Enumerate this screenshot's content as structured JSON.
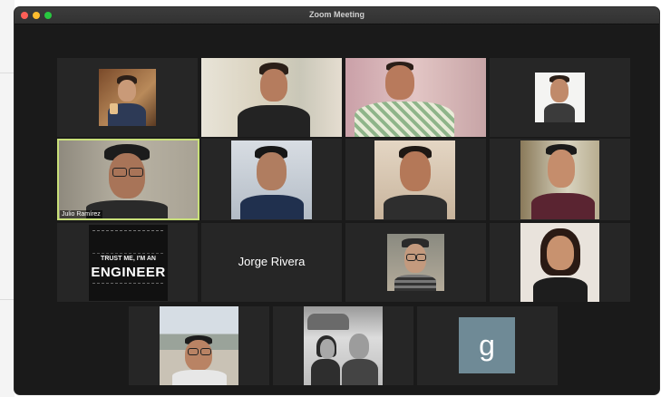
{
  "window": {
    "title": "Zoom Meeting"
  },
  "participants": [
    {
      "display": "video",
      "active": false
    },
    {
      "display": "video",
      "active": false
    },
    {
      "display": "video",
      "active": false
    },
    {
      "display": "video",
      "active": false
    },
    {
      "display": "video",
      "name": "Julio Ramírez",
      "active": true
    },
    {
      "display": "video",
      "active": false
    },
    {
      "display": "video",
      "active": false
    },
    {
      "display": "video",
      "active": false
    },
    {
      "display": "image",
      "image_text": [
        "TRUST ME, I'M AN",
        "ENGINEER"
      ],
      "active": false
    },
    {
      "display": "name",
      "name": "Jorge Rivera",
      "active": false
    },
    {
      "display": "video",
      "active": false
    },
    {
      "display": "video",
      "active": false
    },
    {
      "display": "video",
      "active": false
    },
    {
      "display": "video",
      "active": false
    },
    {
      "display": "initial",
      "initial": "g",
      "active": false
    }
  ],
  "colors": {
    "active_border": "#c9e07a",
    "window_bg": "#1a1a1a",
    "tile_bg": "#262626",
    "avatar_bg": "#6f8a96"
  }
}
